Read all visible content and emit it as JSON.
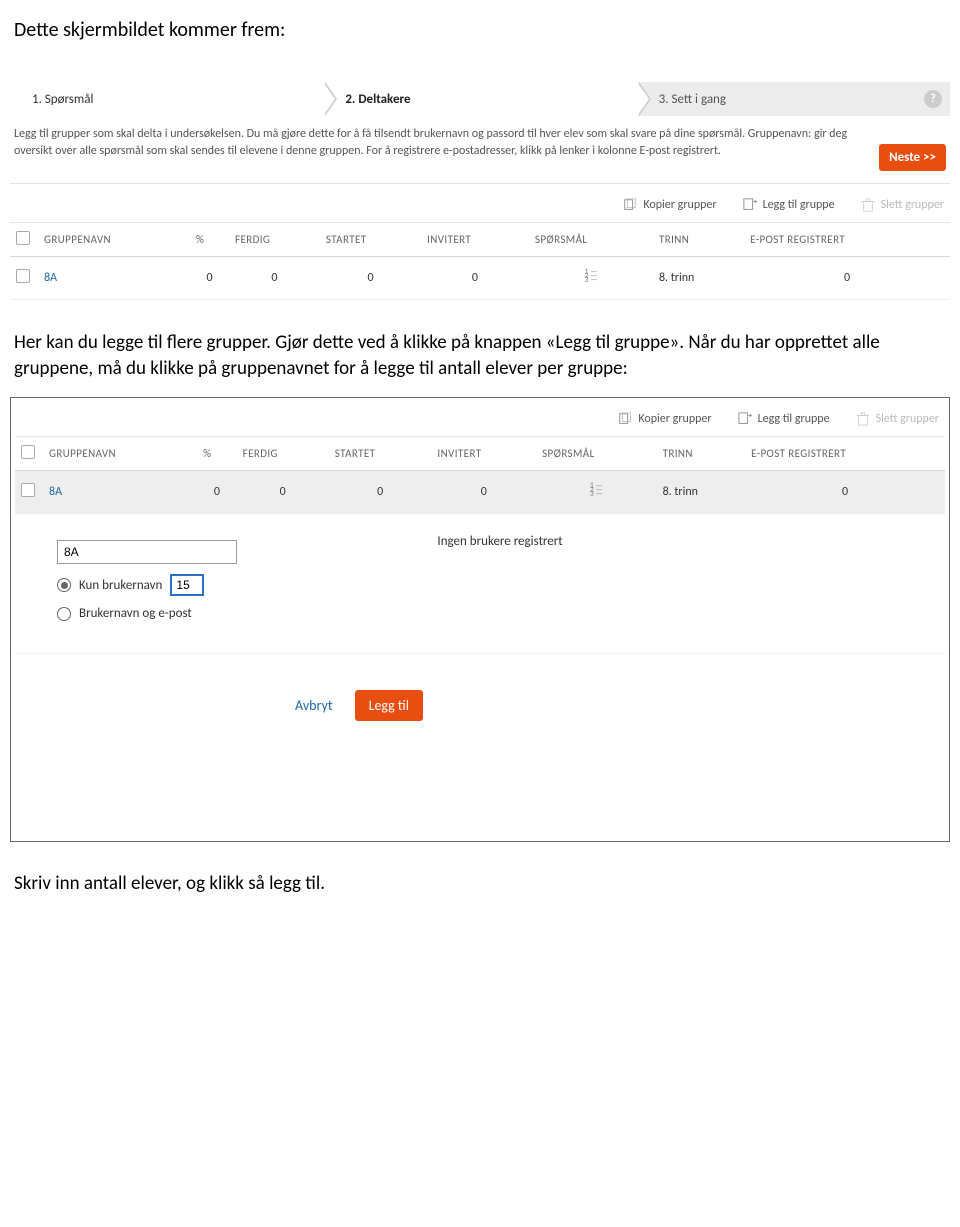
{
  "intro": "Dette skjermbildet kommer frem:",
  "steps": {
    "s1": "1. Spørsmål",
    "s2": "2. Deltakere",
    "s3": "3. Sett i gang",
    "help": "?"
  },
  "instructions": "Legg til grupper som skal delta i undersøkelsen. Du må gjøre dette for å få tilsendt brukernavn og passord til hver elev som skal svare på dine spørsmål. Gruppenavn: gir deg oversikt over alle spørsmål som skal sendes til elevene i denne gruppen. For å registrere e-postadresser, klikk på lenker i kolonne E-post registrert.",
  "next_btn": "Neste >>",
  "actions": {
    "copy": "Kopier grupper",
    "add": "Legg til gruppe",
    "delete": "Slett grupper"
  },
  "headers": {
    "name": "GRUPPENAVN",
    "pct": "%",
    "done": "FERDIG",
    "started": "STARTET",
    "invited": "INVITERT",
    "questions": "SPØRSMÅL",
    "grade": "TRINN",
    "email": "E-POST REGISTRERT"
  },
  "row": {
    "name": "8A",
    "pct": "0",
    "done": "0",
    "started": "0",
    "invited": "0",
    "grade": "8. trinn",
    "email": "0"
  },
  "mid_text": "Her kan du legge til flere grupper. Gjør dette ved å klikke på knappen «Legg til gruppe». Når du har opprettet alle gruppene, må du klikke på gruppenavnet for å legge til antall elever per gruppe:",
  "edit": {
    "name_value": "8A",
    "radio_user_only": "Kun brukernavn",
    "radio_user_email": "Brukernavn og e-post",
    "count_value": "15",
    "status_msg": "Ingen brukere registrert",
    "cancel": "Avbryt",
    "add": "Legg til"
  },
  "outro": "Skriv inn antall elever, og klikk så legg til."
}
